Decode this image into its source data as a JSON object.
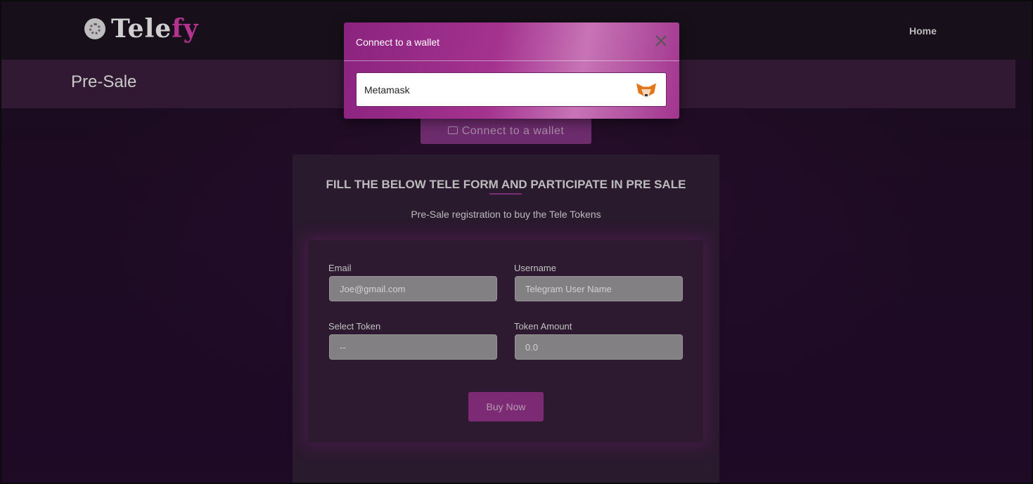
{
  "header": {
    "logo_text_main": "Tele",
    "logo_text_accent": "fy",
    "nav": {
      "home_label": "Home"
    }
  },
  "subheader": {
    "title": "Pre-Sale"
  },
  "connect_button": {
    "label": "Connect to a wallet",
    "icon": "wallet-icon"
  },
  "form": {
    "heading": "FILL THE BELOW TELE FORM AND PARTICIPATE IN PRE SALE",
    "subheading": "Pre-Sale registration to buy the Tele Tokens",
    "email": {
      "label": "Email",
      "placeholder": "Joe@gmail.com"
    },
    "username": {
      "label": "Username",
      "placeholder": "Telegram User Name"
    },
    "token": {
      "label": "Select Token",
      "value": "--"
    },
    "amount": {
      "label": "Token Amount",
      "placeholder": "0.0"
    },
    "buy_label": "Buy Now"
  },
  "modal": {
    "title": "Connect to a wallet",
    "close_icon": "close-icon",
    "options": [
      {
        "name": "Metamask",
        "icon": "metamask-fox-icon"
      }
    ]
  },
  "colors": {
    "accent": "#b3338f",
    "modal_gradient_start": "#8a237f",
    "button": "#7c2a73"
  }
}
